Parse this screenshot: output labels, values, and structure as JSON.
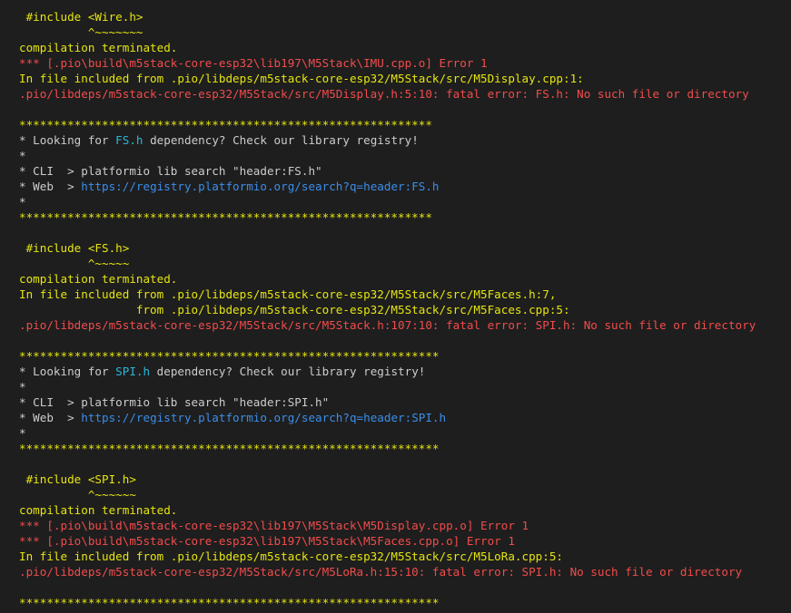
{
  "colors": {
    "background": "#1e1e1e",
    "yellow": "#e5e510",
    "red": "#f14c4c",
    "white": "#cccccc",
    "cyan": "#29b8db",
    "link": "#3b8eea"
  },
  "lines": [
    [
      {
        "t": " #include <Wire.h>",
        "c": "y"
      }
    ],
    [
      {
        "t": "          ^~~~~~~~",
        "c": "y"
      }
    ],
    [
      {
        "t": "compilation terminated.",
        "c": "y"
      }
    ],
    [
      {
        "t": "*** [.pio\\build\\m5stack-core-esp32\\lib197\\M5Stack\\IMU.cpp.o] Error 1",
        "c": "r"
      }
    ],
    [
      {
        "t": "In file included from .pio/libdeps/m5stack-core-esp32/M5Stack/src/M5Display.cpp:1:",
        "c": "y"
      }
    ],
    [
      {
        "t": ".pio/libdeps/m5stack-core-esp32/M5Stack/src/M5Display.h:5:10: fatal error: FS.h: No such file or directory",
        "c": "r"
      }
    ],
    [
      {
        "t": "",
        "c": "w"
      }
    ],
    [
      {
        "t": "************************************************************",
        "c": "y"
      }
    ],
    [
      {
        "t": "* Looking for ",
        "c": "w"
      },
      {
        "t": "FS.h",
        "c": "c"
      },
      {
        "t": " dependency? Check our library registry!",
        "c": "w"
      }
    ],
    [
      {
        "t": "*",
        "c": "w"
      }
    ],
    [
      {
        "t": "* CLI  > platformio lib search \"header:FS.h\"",
        "c": "w"
      }
    ],
    [
      {
        "t": "* Web  > ",
        "c": "w"
      },
      {
        "t": "https://registry.platformio.org/search?q=header:FS.h",
        "c": "l"
      }
    ],
    [
      {
        "t": "*",
        "c": "w"
      }
    ],
    [
      {
        "t": "************************************************************",
        "c": "y"
      }
    ],
    [
      {
        "t": "",
        "c": "w"
      }
    ],
    [
      {
        "t": " #include <FS.h>",
        "c": "y"
      }
    ],
    [
      {
        "t": "          ^~~~~~",
        "c": "y"
      }
    ],
    [
      {
        "t": "compilation terminated.",
        "c": "y"
      }
    ],
    [
      {
        "t": "In file included from .pio/libdeps/m5stack-core-esp32/M5Stack/src/M5Faces.h:7,",
        "c": "y"
      }
    ],
    [
      {
        "t": "                 from .pio/libdeps/m5stack-core-esp32/M5Stack/src/M5Faces.cpp:5:",
        "c": "y"
      }
    ],
    [
      {
        "t": ".pio/libdeps/m5stack-core-esp32/M5Stack/src/M5Stack.h:107:10: fatal error: SPI.h: No such file or directory",
        "c": "r"
      }
    ],
    [
      {
        "t": "",
        "c": "w"
      }
    ],
    [
      {
        "t": "*************************************************************",
        "c": "y"
      }
    ],
    [
      {
        "t": "* Looking for ",
        "c": "w"
      },
      {
        "t": "SPI.h",
        "c": "c"
      },
      {
        "t": " dependency? Check our library registry!",
        "c": "w"
      }
    ],
    [
      {
        "t": "*",
        "c": "w"
      }
    ],
    [
      {
        "t": "* CLI  > platformio lib search \"header:SPI.h\"",
        "c": "w"
      }
    ],
    [
      {
        "t": "* Web  > ",
        "c": "w"
      },
      {
        "t": "https://registry.platformio.org/search?q=header:SPI.h",
        "c": "l"
      }
    ],
    [
      {
        "t": "*",
        "c": "w"
      }
    ],
    [
      {
        "t": "*************************************************************",
        "c": "y"
      }
    ],
    [
      {
        "t": "",
        "c": "w"
      }
    ],
    [
      {
        "t": " #include <SPI.h>",
        "c": "y"
      }
    ],
    [
      {
        "t": "          ^~~~~~~",
        "c": "y"
      }
    ],
    [
      {
        "t": "compilation terminated.",
        "c": "y"
      }
    ],
    [
      {
        "t": "*** [.pio\\build\\m5stack-core-esp32\\lib197\\M5Stack\\M5Display.cpp.o] Error 1",
        "c": "r"
      }
    ],
    [
      {
        "t": "*** [.pio\\build\\m5stack-core-esp32\\lib197\\M5Stack\\M5Faces.cpp.o] Error 1",
        "c": "r"
      }
    ],
    [
      {
        "t": "In file included from .pio/libdeps/m5stack-core-esp32/M5Stack/src/M5LoRa.cpp:5:",
        "c": "y"
      }
    ],
    [
      {
        "t": ".pio/libdeps/m5stack-core-esp32/M5Stack/src/M5LoRa.h:15:10: fatal error: SPI.h: No such file or directory",
        "c": "r"
      }
    ],
    [
      {
        "t": "",
        "c": "w"
      }
    ],
    [
      {
        "t": "*************************************************************",
        "c": "y"
      }
    ]
  ]
}
